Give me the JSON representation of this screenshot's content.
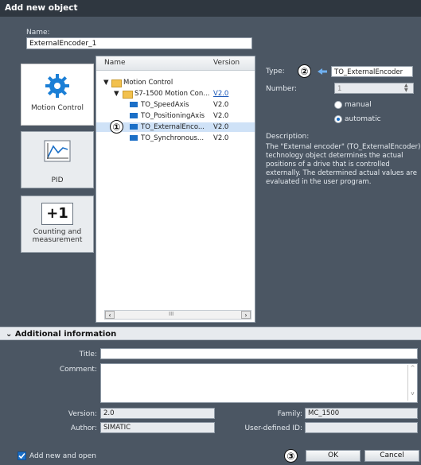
{
  "window": {
    "title": "Add new object"
  },
  "name": {
    "label": "Name:",
    "value": "ExternalEncoder_1"
  },
  "categories": [
    {
      "label": "Motion Control",
      "icon": "gear-icon"
    },
    {
      "label": "PID",
      "icon": "chart-icon"
    },
    {
      "label": "Counting and measurement",
      "icon": "plus-one-icon"
    }
  ],
  "tree": {
    "col_name": "Name",
    "col_version": "Version",
    "rows": [
      {
        "name": "Motion Control",
        "version": ""
      },
      {
        "name": "S7-1500 Motion Con...",
        "version": "V2.0"
      },
      {
        "name": "TO_SpeedAxis",
        "version": "V2.0"
      },
      {
        "name": "TO_PositioningAxis",
        "version": "V2.0"
      },
      {
        "name": "TO_ExternalEnco...",
        "version": "V2.0"
      },
      {
        "name": "TO_Synchronous...",
        "version": "V2.0"
      }
    ],
    "scroll_mid": "III"
  },
  "props": {
    "type_label": "Type:",
    "type_value": "TO_ExternalEncoder",
    "number_label": "Number:",
    "number_value": "1",
    "radio_manual": "manual",
    "radio_automatic": "automatic",
    "description_label": "Description:",
    "description_text": "The \"External encoder\" (TO_ExternalEncoder) technology object determines the actual positions of a drive that is controlled externally. The determined actual values are evaluated in the user program."
  },
  "markers": {
    "m1": "①",
    "m2": "②",
    "m3": "③"
  },
  "additional": {
    "header": "Additional information",
    "title_label": "Title:",
    "title_value": "",
    "comment_label": "Comment:",
    "comment_value": "",
    "version_label": "Version:",
    "version_value": "2.0",
    "author_label": "Author:",
    "author_value": "SIMATIC",
    "family_label": "Family:",
    "family_value": "MC_1500",
    "userid_label": "User-defined ID:",
    "userid_value": ""
  },
  "footer": {
    "add_new_open": "Add new and open",
    "ok": "OK",
    "cancel": "Cancel"
  },
  "colors": {
    "accent": "#1b6fc7",
    "selection": "#cfe2f7",
    "panel": "#4b5663"
  }
}
